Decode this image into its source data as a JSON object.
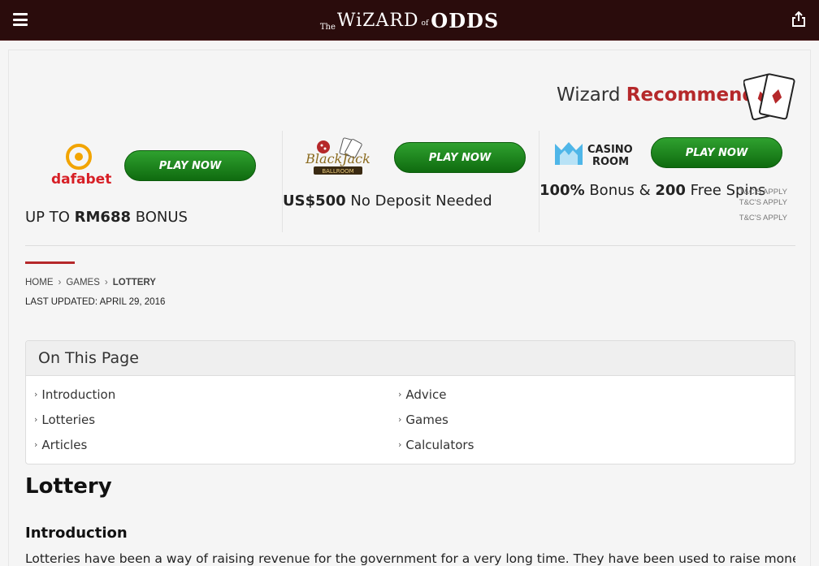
{
  "header": {
    "logo": {
      "the": "The",
      "wizard": "WiZARD",
      "of": "of",
      "odds": "ODDS"
    },
    "menu_icon": "hamburger-menu-icon",
    "share_icon": "share-icon"
  },
  "recommends": {
    "prefix": "Wizard",
    "highlight": "Recommends",
    "icon": "playing-cards-icon"
  },
  "offers": [
    {
      "brand": "dafabet",
      "button": "PLAY NOW",
      "text_pre": "UP TO ",
      "text_bold": "RM688",
      "text_post": " BONUS"
    },
    {
      "brand": "BlackJack Ballroom",
      "button": "PLAY NOW",
      "text_bold": "US$500",
      "text_post": " No Deposit Needed"
    },
    {
      "brand": "CASINO ROOM",
      "button": "PLAY NOW",
      "text_bold1": "100%",
      "text_mid": " Bonus & ",
      "text_bold2": "200",
      "text_post": " Free Spins",
      "tc": [
        "T&C'S APPLY",
        "T&C'S APPLY",
        "T&C'S APPLY"
      ]
    }
  ],
  "breadcrumb": {
    "home": "HOME",
    "games": "GAMES",
    "current": "LOTTERY",
    "separator": "›"
  },
  "last_updated": "LAST UPDATED: APRIL 29, 2016",
  "toc": {
    "title": "On This Page",
    "left": [
      "Introduction",
      "Lotteries",
      "Articles"
    ],
    "right": [
      "Advice",
      "Games",
      "Calculators"
    ]
  },
  "page_title": "Lottery",
  "section_title": "Introduction",
  "intro_text": "Lotteries have been a way of raising revenue for the government for a very long time. They have been used to raise money for special"
}
